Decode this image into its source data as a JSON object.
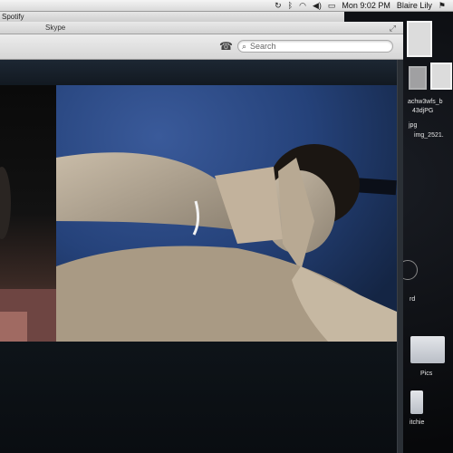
{
  "menubar": {
    "time": "Mon 9:02 PM",
    "user": "Blaire Lily",
    "icons": [
      "time-machine-icon",
      "bluetooth-icon",
      "wifi-icon",
      "volume-icon",
      "battery-icon",
      "flag-icon"
    ]
  },
  "background_window": {
    "title": "Spotify"
  },
  "skype": {
    "title": "Skype",
    "search_placeholder": "Search"
  },
  "desktop": {
    "items": [
      {
        "label": "achw3wfs_b"
      },
      {
        "label": "43djPG"
      },
      {
        "label": "jpg"
      },
      {
        "label": "img_2521."
      },
      {
        "label": "rd"
      },
      {
        "label": "Pics"
      },
      {
        "label": "itchie"
      }
    ]
  },
  "colors": {
    "menubar": "#dedede",
    "video_blue": "#25427a",
    "window_dark": "#0e1216"
  }
}
